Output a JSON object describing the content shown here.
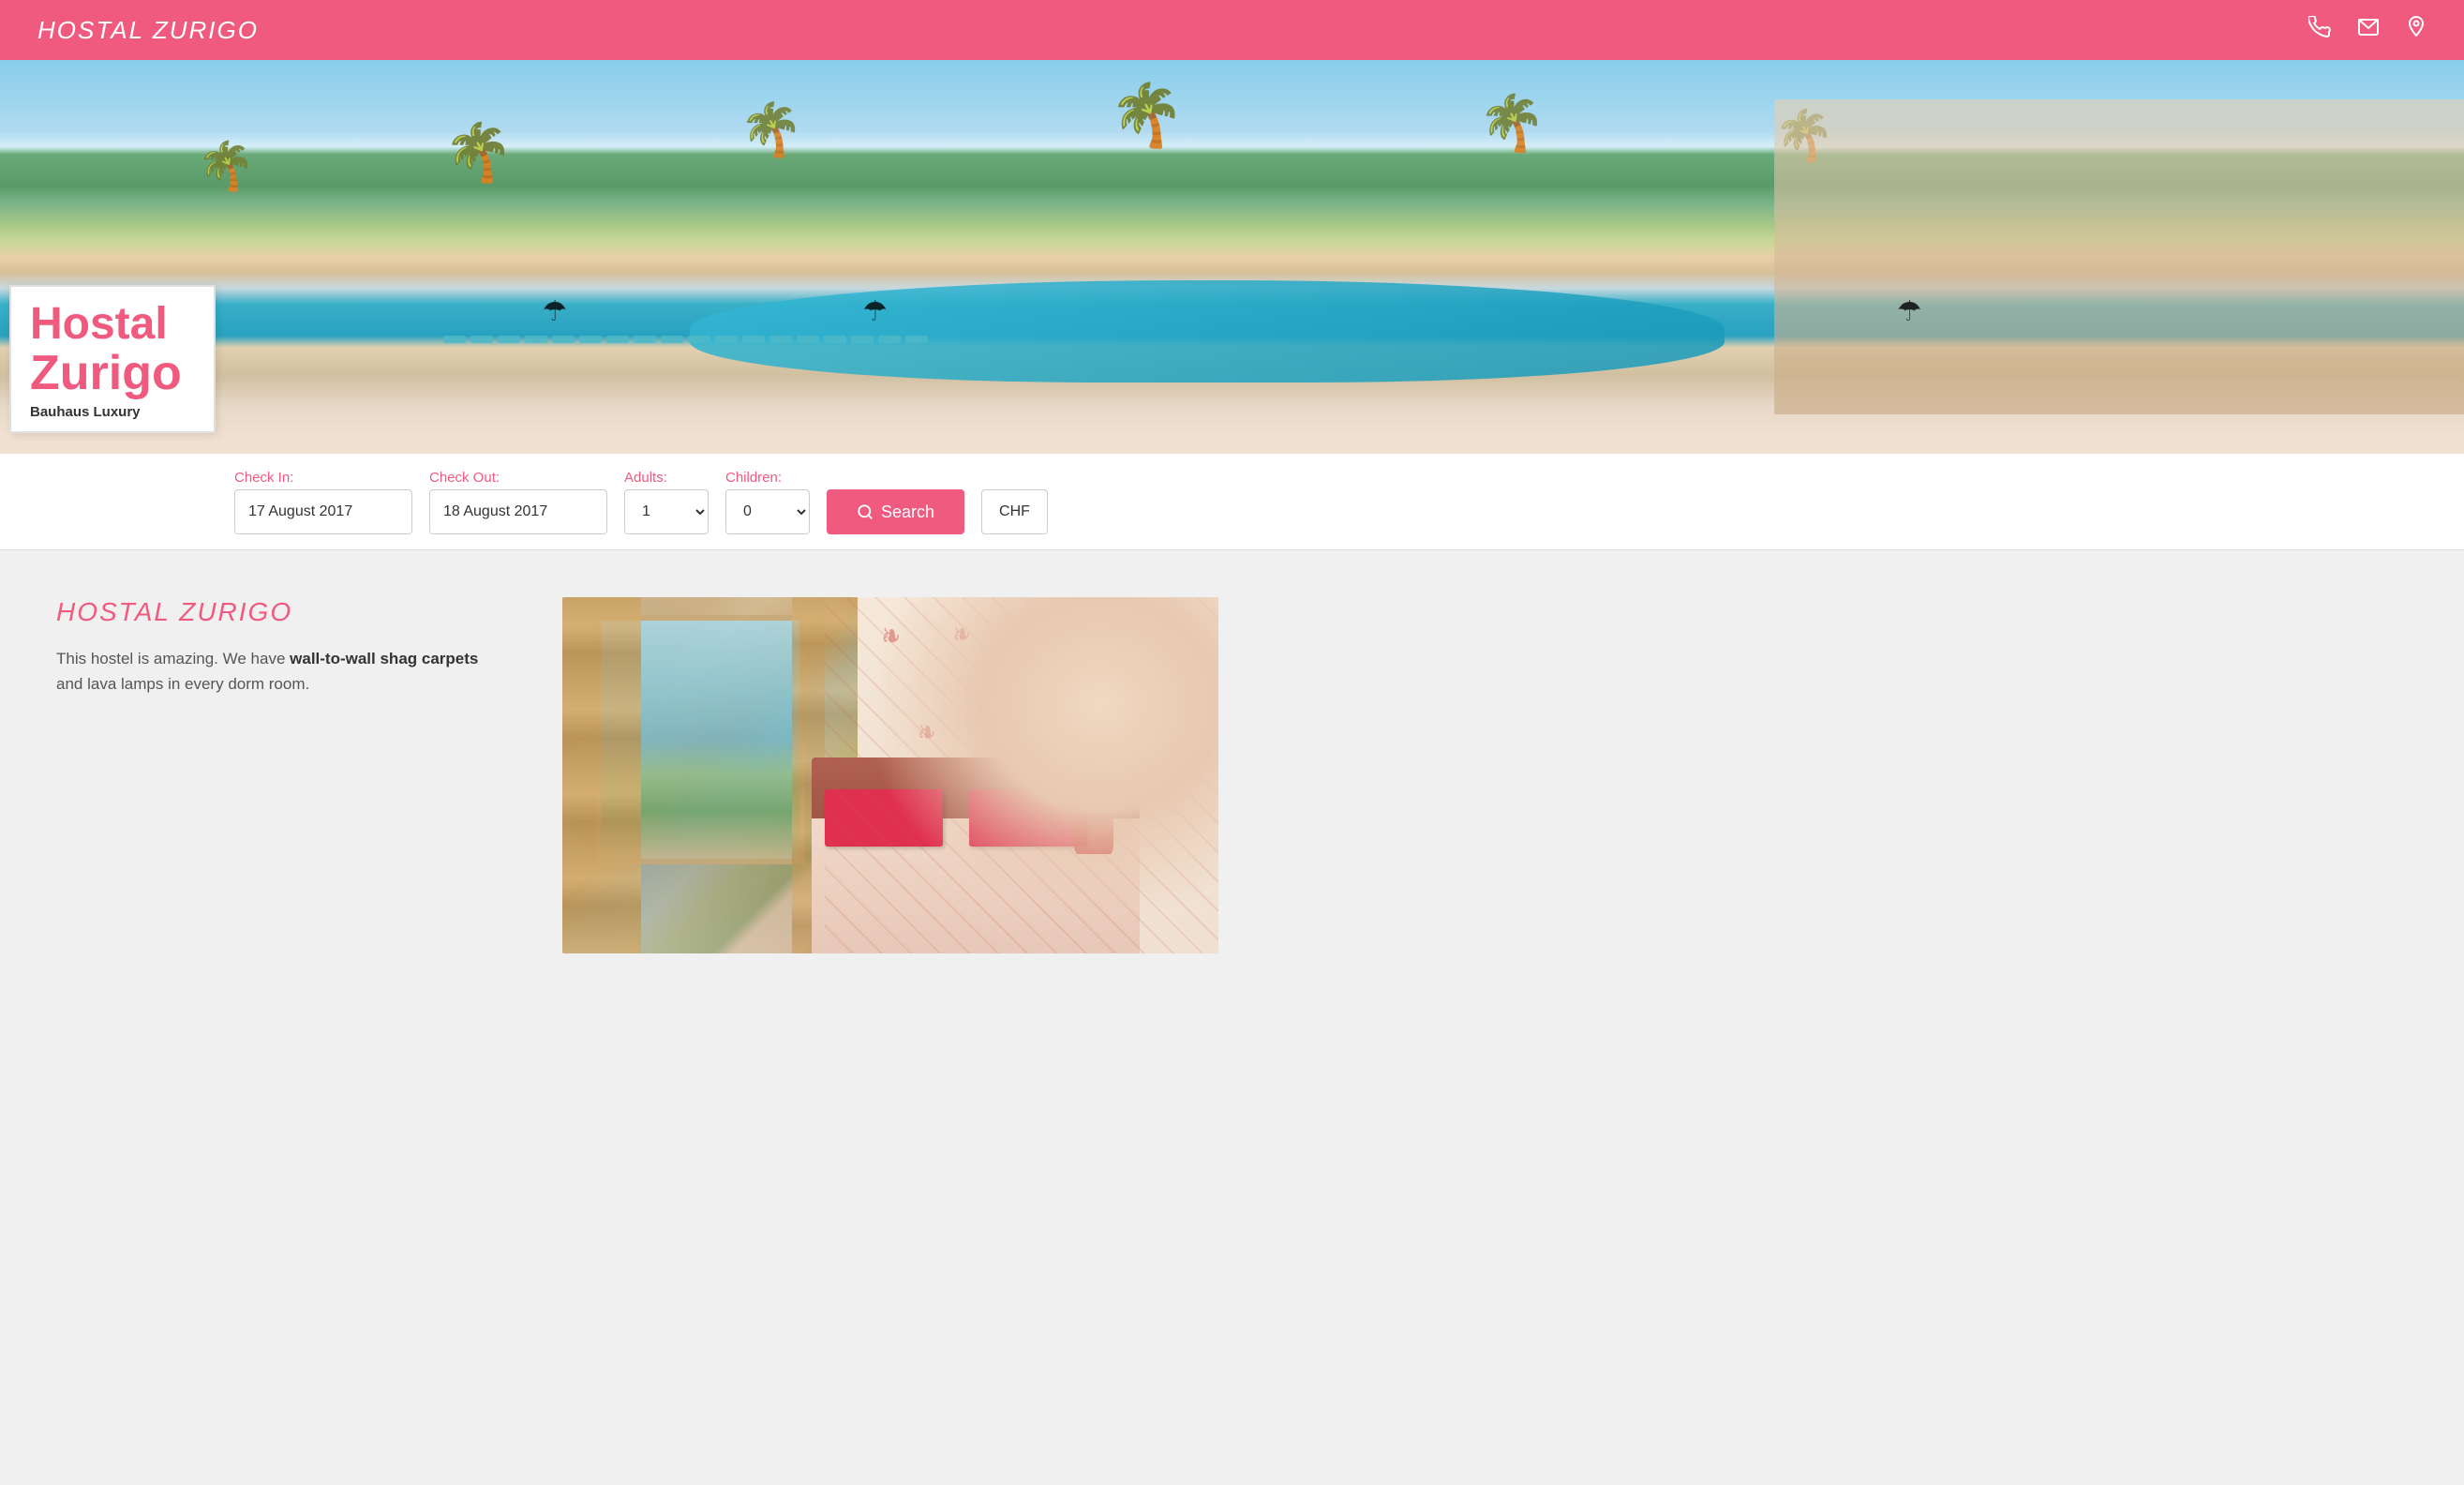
{
  "header": {
    "title": "HOSTAL ZURIGO",
    "phone_icon": "☎",
    "email_icon": "✉",
    "location_icon": "⚲"
  },
  "logo": {
    "line1": "Hostal",
    "line2": "Zurigo",
    "subtitle": "Bauhaus Luxury"
  },
  "booking": {
    "checkin_label": "Check In:",
    "checkin_value": "17 August 2017",
    "checkout_label": "Check Out:",
    "checkout_value": "18 August 2017",
    "adults_label": "Adults:",
    "adults_value": "1",
    "children_label": "Children:",
    "children_value": "0",
    "search_label": "Search",
    "currency_label": "CHF"
  },
  "content": {
    "title": "HOSTAL ZURIGO",
    "description_part1": "This hostel is amazing. We have ",
    "description_bold": "wall-to-wall shag carpets",
    "description_part2": " and lava lamps in every dorm room."
  }
}
